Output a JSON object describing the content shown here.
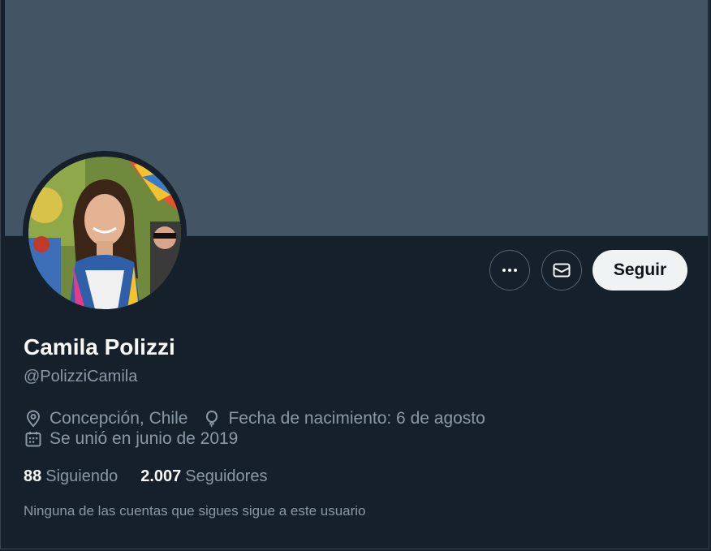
{
  "profile": {
    "display_name": "Camila Polizzi",
    "handle": "@PolizziCamila",
    "location": "Concepción, Chile",
    "birthday": "Fecha de nacimiento: 6 de agosto",
    "joined": "Se unió en junio de 2019"
  },
  "actions": {
    "follow_label": "Seguir",
    "more_icon": "more-horizontal-icon",
    "message_icon": "envelope-icon"
  },
  "stats": {
    "following_count": "88",
    "following_label": "Siguiendo",
    "followers_count": "2.007",
    "followers_label": "Seguidores"
  },
  "notice": "Ninguna de las cuentas que sigues sigue a este usuario",
  "colors": {
    "background": "#15202b",
    "banner": "#435565",
    "secondary_text": "#8b98a5",
    "follow_button_bg": "#eff3f4"
  }
}
